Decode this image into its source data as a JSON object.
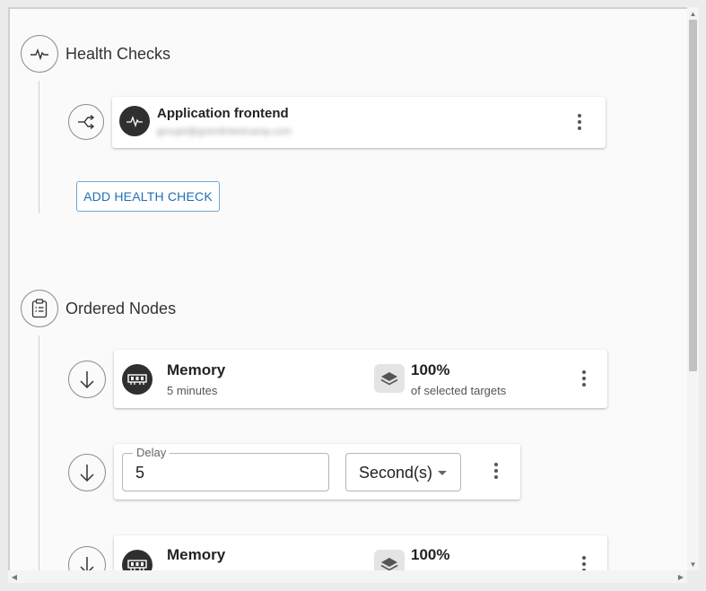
{
  "health_checks": {
    "title": "Health Checks",
    "items": [
      {
        "title": "Application frontend",
        "subtitle": "group0@gremlintestcamp.com"
      }
    ],
    "add_button": "ADD HEALTH CHECK"
  },
  "ordered_nodes": {
    "title": "Ordered Nodes",
    "nodes": [
      {
        "type": "attack",
        "name": "Memory",
        "duration": "5 minutes",
        "percent": "100%",
        "percent_caption": "of selected targets"
      },
      {
        "type": "delay",
        "label": "Delay",
        "value": "5",
        "unit": "Second(s)"
      },
      {
        "type": "attack",
        "name": "Memory",
        "percent": "100%"
      }
    ]
  },
  "icons": {
    "heartbeat": "heartbeat-icon",
    "branch": "branch-icon",
    "clipboard": "clipboard-list-icon",
    "arrow_down": "arrow-down-icon",
    "memory": "memory-chip-icon",
    "layers": "layers-icon"
  }
}
